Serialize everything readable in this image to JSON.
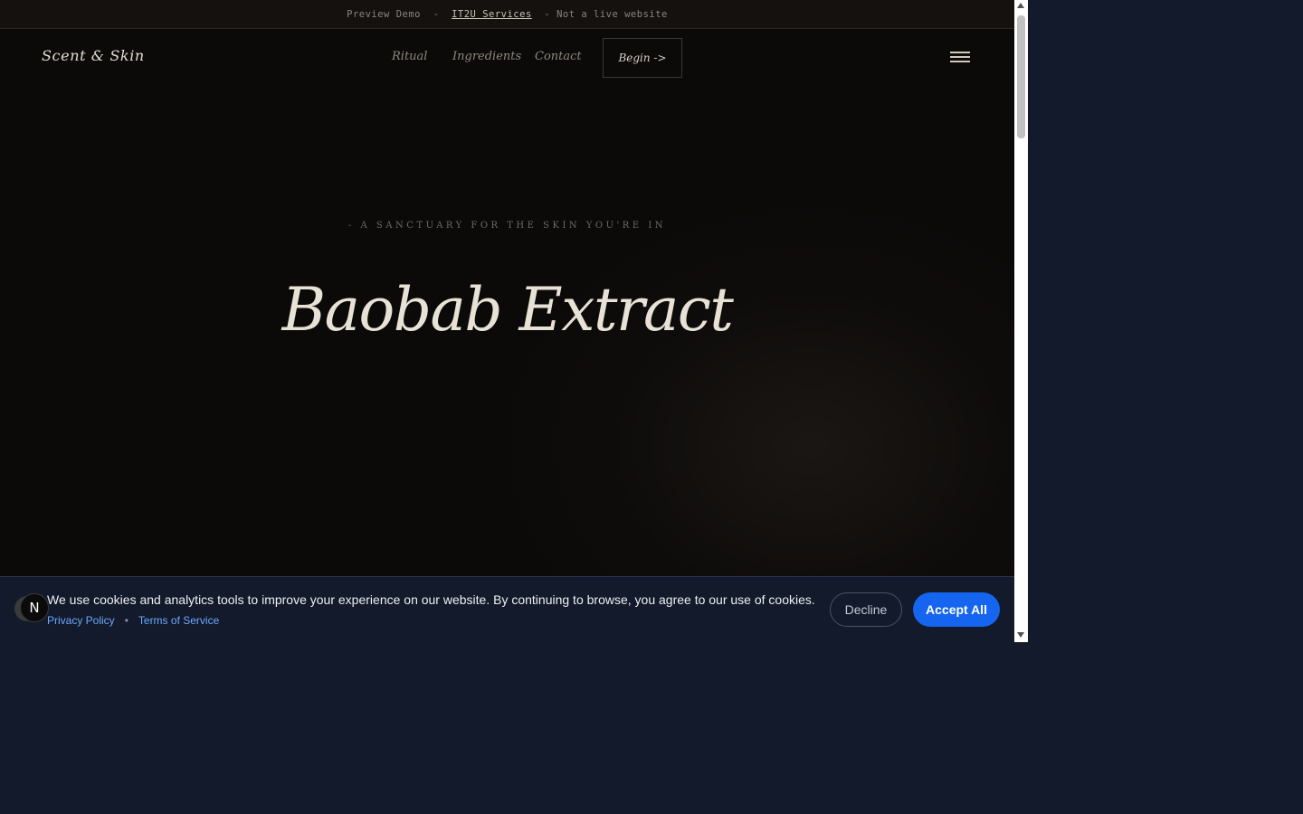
{
  "demo_banner": {
    "prefix": "Preview Demo  -  ",
    "link": "IT2U Services",
    "suffix": "  - Not a live website"
  },
  "navbar": {
    "logo": "Scent & Skin",
    "links": [
      "Ritual",
      "Ingredients",
      "Contact"
    ],
    "cta": "Begin ->",
    "menu_icon": "hamburger-icon"
  },
  "hero": {
    "tagline": "- A SANCTUARY FOR THE SKIN YOU'RE IN",
    "title": "Baobab Extract"
  },
  "cookie_banner": {
    "badge": "N",
    "message": "We use cookies and analytics tools to improve your experience on our website. By continuing to browse, you agree to our use of cookies.",
    "privacy_link": "Privacy Policy",
    "separator": "•",
    "terms_link": "Terms of Service",
    "decline": "Decline",
    "accept": "Accept All"
  },
  "colors": {
    "page_bg": "#0c0a09",
    "banner_bg": "#121a2b",
    "accent": "#1565f0",
    "link": "#6ea8ff"
  }
}
